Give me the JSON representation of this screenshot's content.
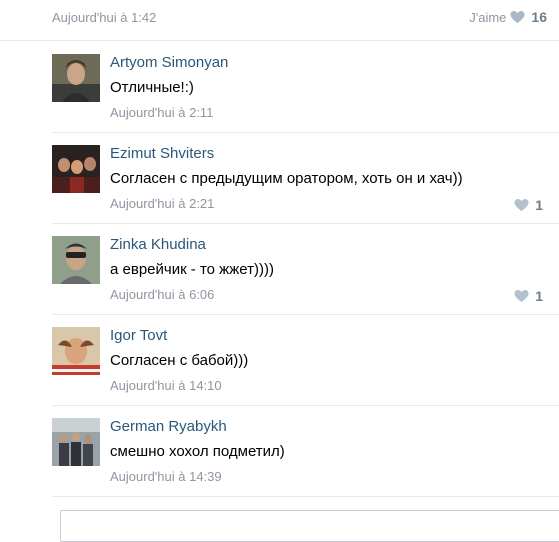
{
  "post": {
    "date": "Aujourd'hui à 1:42",
    "like_label": "J'aime",
    "like_count": "16"
  },
  "icons": {
    "like": "heart-icon"
  },
  "colors": {
    "author_link": "#2b587a",
    "meta_gray": "#8f96a0",
    "like_gray": "#6f7c89"
  },
  "comments": [
    {
      "author": "Artyom Simonyan",
      "text": "Отличные!:)",
      "date": "Aujourd'hui à 2:11",
      "likes": ""
    },
    {
      "author": "Ezimut Shviters",
      "text": "Согласен с предыдущим оратором, хоть он и хач))",
      "date": "Aujourd'hui à 2:21",
      "likes": "1"
    },
    {
      "author": "Zinka Khudina",
      "text": "а еврейчик - то жжет))))",
      "date": "Aujourd'hui à 6:06",
      "likes": "1"
    },
    {
      "author": "Igor Tovt",
      "text": "Согласен с бабой)))",
      "date": "Aujourd'hui à 14:10",
      "likes": ""
    },
    {
      "author": "German Ryabykh",
      "text": "смешно хохол подметил)",
      "date": "Aujourd'hui à 14:39",
      "likes": ""
    }
  ]
}
